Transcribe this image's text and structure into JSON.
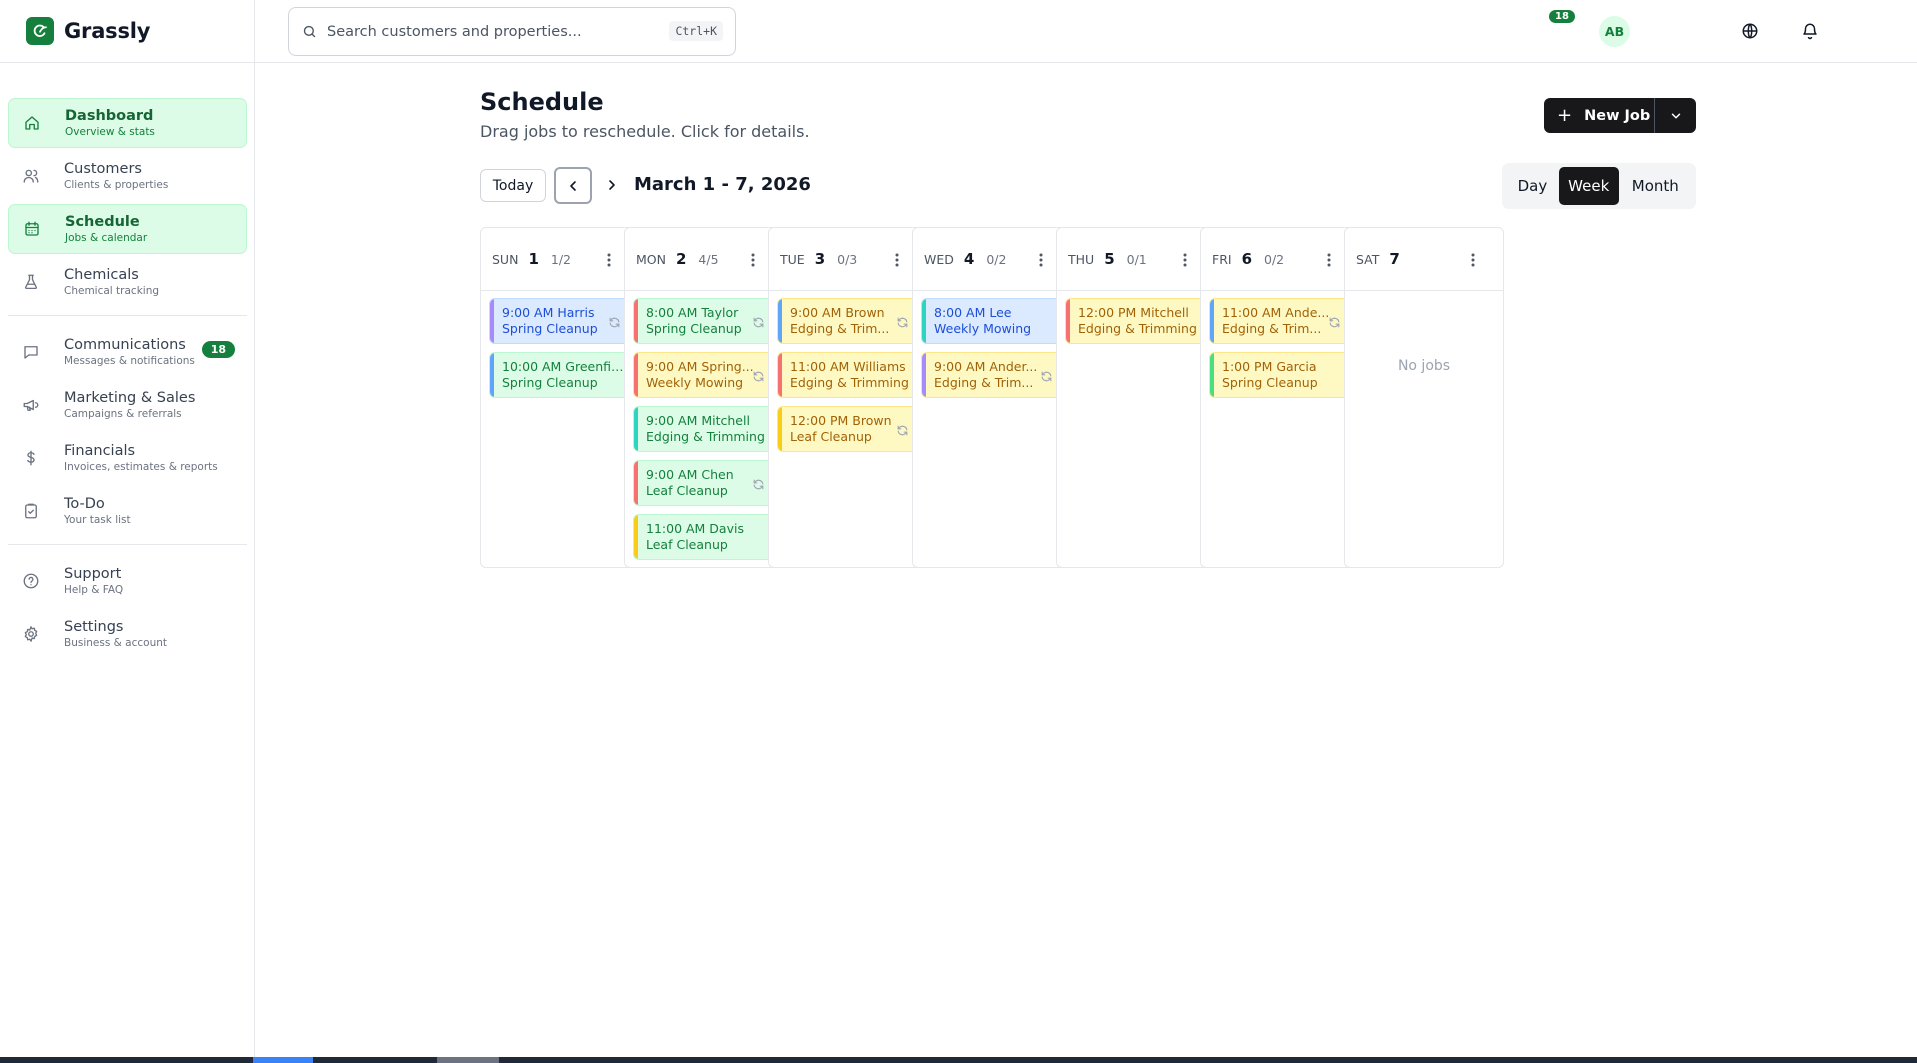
{
  "app": {
    "name": "Grassly"
  },
  "search": {
    "placeholder": "Search customers and properties...",
    "shortcut": "Ctrl+K"
  },
  "header": {
    "notification_count": "18",
    "avatar_initials": "AB"
  },
  "sidebar": {
    "items": [
      {
        "id": "dashboard",
        "label": "Dashboard",
        "sub": "Overview & stats",
        "icon": "home-icon",
        "active": true
      },
      {
        "id": "customers",
        "label": "Customers",
        "sub": "Clients & properties",
        "icon": "users-icon",
        "active": false
      },
      {
        "id": "schedule",
        "label": "Schedule",
        "sub": "Jobs & calendar",
        "icon": "calendar-icon",
        "active": true
      },
      {
        "id": "chemicals",
        "label": "Chemicals",
        "sub": "Chemical tracking",
        "icon": "flask-icon",
        "active": false
      },
      {
        "id": "communications",
        "label": "Communications",
        "sub": "Messages & notifications",
        "icon": "message-icon",
        "badge": "18",
        "active": false
      },
      {
        "id": "marketing",
        "label": "Marketing & Sales",
        "sub": "Campaigns & referrals",
        "icon": "megaphone-icon",
        "active": false
      },
      {
        "id": "financials",
        "label": "Financials",
        "sub": "Invoices, estimates & reports",
        "icon": "dollar-icon",
        "active": false
      },
      {
        "id": "todo",
        "label": "To-Do",
        "sub": "Your task list",
        "icon": "clipboard-check-icon",
        "active": false
      },
      {
        "id": "support",
        "label": "Support",
        "sub": "Help & FAQ",
        "icon": "help-circle-icon",
        "active": false
      },
      {
        "id": "settings",
        "label": "Settings",
        "sub": "Business & account",
        "icon": "gear-icon",
        "active": false
      }
    ]
  },
  "page": {
    "title": "Schedule",
    "subtitle": "Drag jobs to reschedule. Click for details.",
    "new_job_label": "New Job"
  },
  "toolbar": {
    "today_label": "Today",
    "range_label": "March 1 - 7, 2026",
    "views": [
      "Day",
      "Week",
      "Month"
    ],
    "active_view": "Week"
  },
  "colors": {
    "brand": "#15803d",
    "bar_purple": "#a78bfa",
    "bar_teal": "#2dd4bf",
    "bar_red": "#f87171",
    "bar_orange": "#fb923c",
    "bar_blue": "#60a5fa",
    "bar_yellow": "#facc15",
    "bar_green": "#4ade80"
  },
  "empty_label": "No jobs",
  "days": [
    {
      "dow": "SUN",
      "num": "1",
      "count": "1/2",
      "jobs": [
        {
          "line1": "9:00 AM Harris",
          "line2": "Spring Cleanup",
          "tone": "blue",
          "bar": "#a78bfa",
          "recurring": true
        },
        {
          "line1": "10:00 AM Greenfiel...",
          "line2": "Spring Cleanup",
          "tone": "green",
          "bar": "#60a5fa",
          "recurring": false
        }
      ]
    },
    {
      "dow": "MON",
      "num": "2",
      "count": "4/5",
      "jobs": [
        {
          "line1": "8:00 AM Taylor",
          "line2": "Spring Cleanup",
          "tone": "green",
          "bar": "#f87171",
          "recurring": true
        },
        {
          "line1": "9:00 AM Spring...",
          "line2": "Weekly Mowing",
          "tone": "yellow",
          "bar": "#f87171",
          "recurring": true
        },
        {
          "line1": "9:00 AM Mitchell",
          "line2": "Edging & Trimming",
          "tone": "green",
          "bar": "#2dd4bf",
          "recurring": false
        },
        {
          "line1": "9:00 AM Chen",
          "line2": "Leaf Cleanup",
          "tone": "green",
          "bar": "#f87171",
          "recurring": true
        },
        {
          "line1": "11:00 AM Davis",
          "line2": "Leaf Cleanup",
          "tone": "green",
          "bar": "#facc15",
          "recurring": false
        }
      ]
    },
    {
      "dow": "TUE",
      "num": "3",
      "count": "0/3",
      "jobs": [
        {
          "line1": "9:00 AM Brown",
          "line2": "Edging & Trim...",
          "tone": "yellow",
          "bar": "#60a5fa",
          "recurring": true
        },
        {
          "line1": "11:00 AM Williams",
          "line2": "Edging & Trimming",
          "tone": "yellow",
          "bar": "#f87171",
          "recurring": false
        },
        {
          "line1": "12:00 PM Brown",
          "line2": "Leaf Cleanup",
          "tone": "yellow",
          "bar": "#facc15",
          "recurring": true
        }
      ]
    },
    {
      "dow": "WED",
      "num": "4",
      "count": "0/2",
      "jobs": [
        {
          "line1": "8:00 AM Lee",
          "line2": "Weekly Mowing",
          "tone": "blue",
          "bar": "#2dd4bf",
          "recurring": false
        },
        {
          "line1": "9:00 AM Ander...",
          "line2": "Edging & Trim...",
          "tone": "yellow",
          "bar": "#a78bfa",
          "recurring": true
        }
      ]
    },
    {
      "dow": "THU",
      "num": "5",
      "count": "0/1",
      "jobs": [
        {
          "line1": "12:00 PM Mitchell",
          "line2": "Edging & Trimming",
          "tone": "yellow",
          "bar": "#f87171",
          "recurring": false
        }
      ]
    },
    {
      "dow": "FRI",
      "num": "6",
      "count": "0/2",
      "jobs": [
        {
          "line1": "11:00 AM Ande...",
          "line2": "Edging & Trim...",
          "tone": "yellow",
          "bar": "#60a5fa",
          "recurring": true
        },
        {
          "line1": "1:00 PM Garcia",
          "line2": "Spring Cleanup",
          "tone": "yellow",
          "bar": "#4ade80",
          "recurring": false
        }
      ]
    },
    {
      "dow": "SAT",
      "num": "7",
      "count": "",
      "jobs": []
    }
  ]
}
